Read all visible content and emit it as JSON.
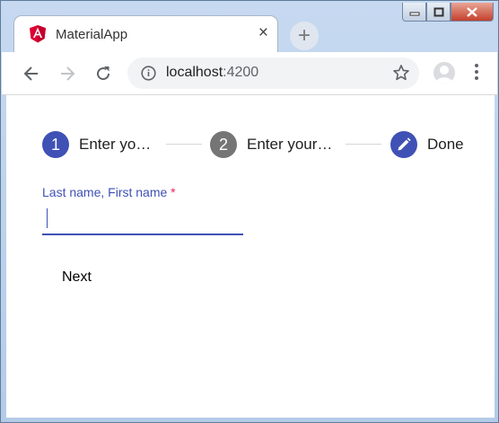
{
  "browser": {
    "tab_title": "MaterialApp",
    "tab_close": "×",
    "new_tab": "+",
    "url_host": "localhost",
    "url_port": ":4200"
  },
  "stepper": {
    "steps": [
      {
        "number": "1",
        "label": "Enter yo…",
        "state": "active"
      },
      {
        "number": "2",
        "label": "Enter your…",
        "state": "inactive"
      },
      {
        "number": "",
        "label": "Done",
        "state": "edit"
      }
    ]
  },
  "form": {
    "field_label": "Last name, First name",
    "required_marker": "*",
    "field_value": "",
    "next_label": "Next"
  },
  "colors": {
    "primary": "#3f51b5",
    "inactive_step": "#757575",
    "required": "#e91e63"
  }
}
